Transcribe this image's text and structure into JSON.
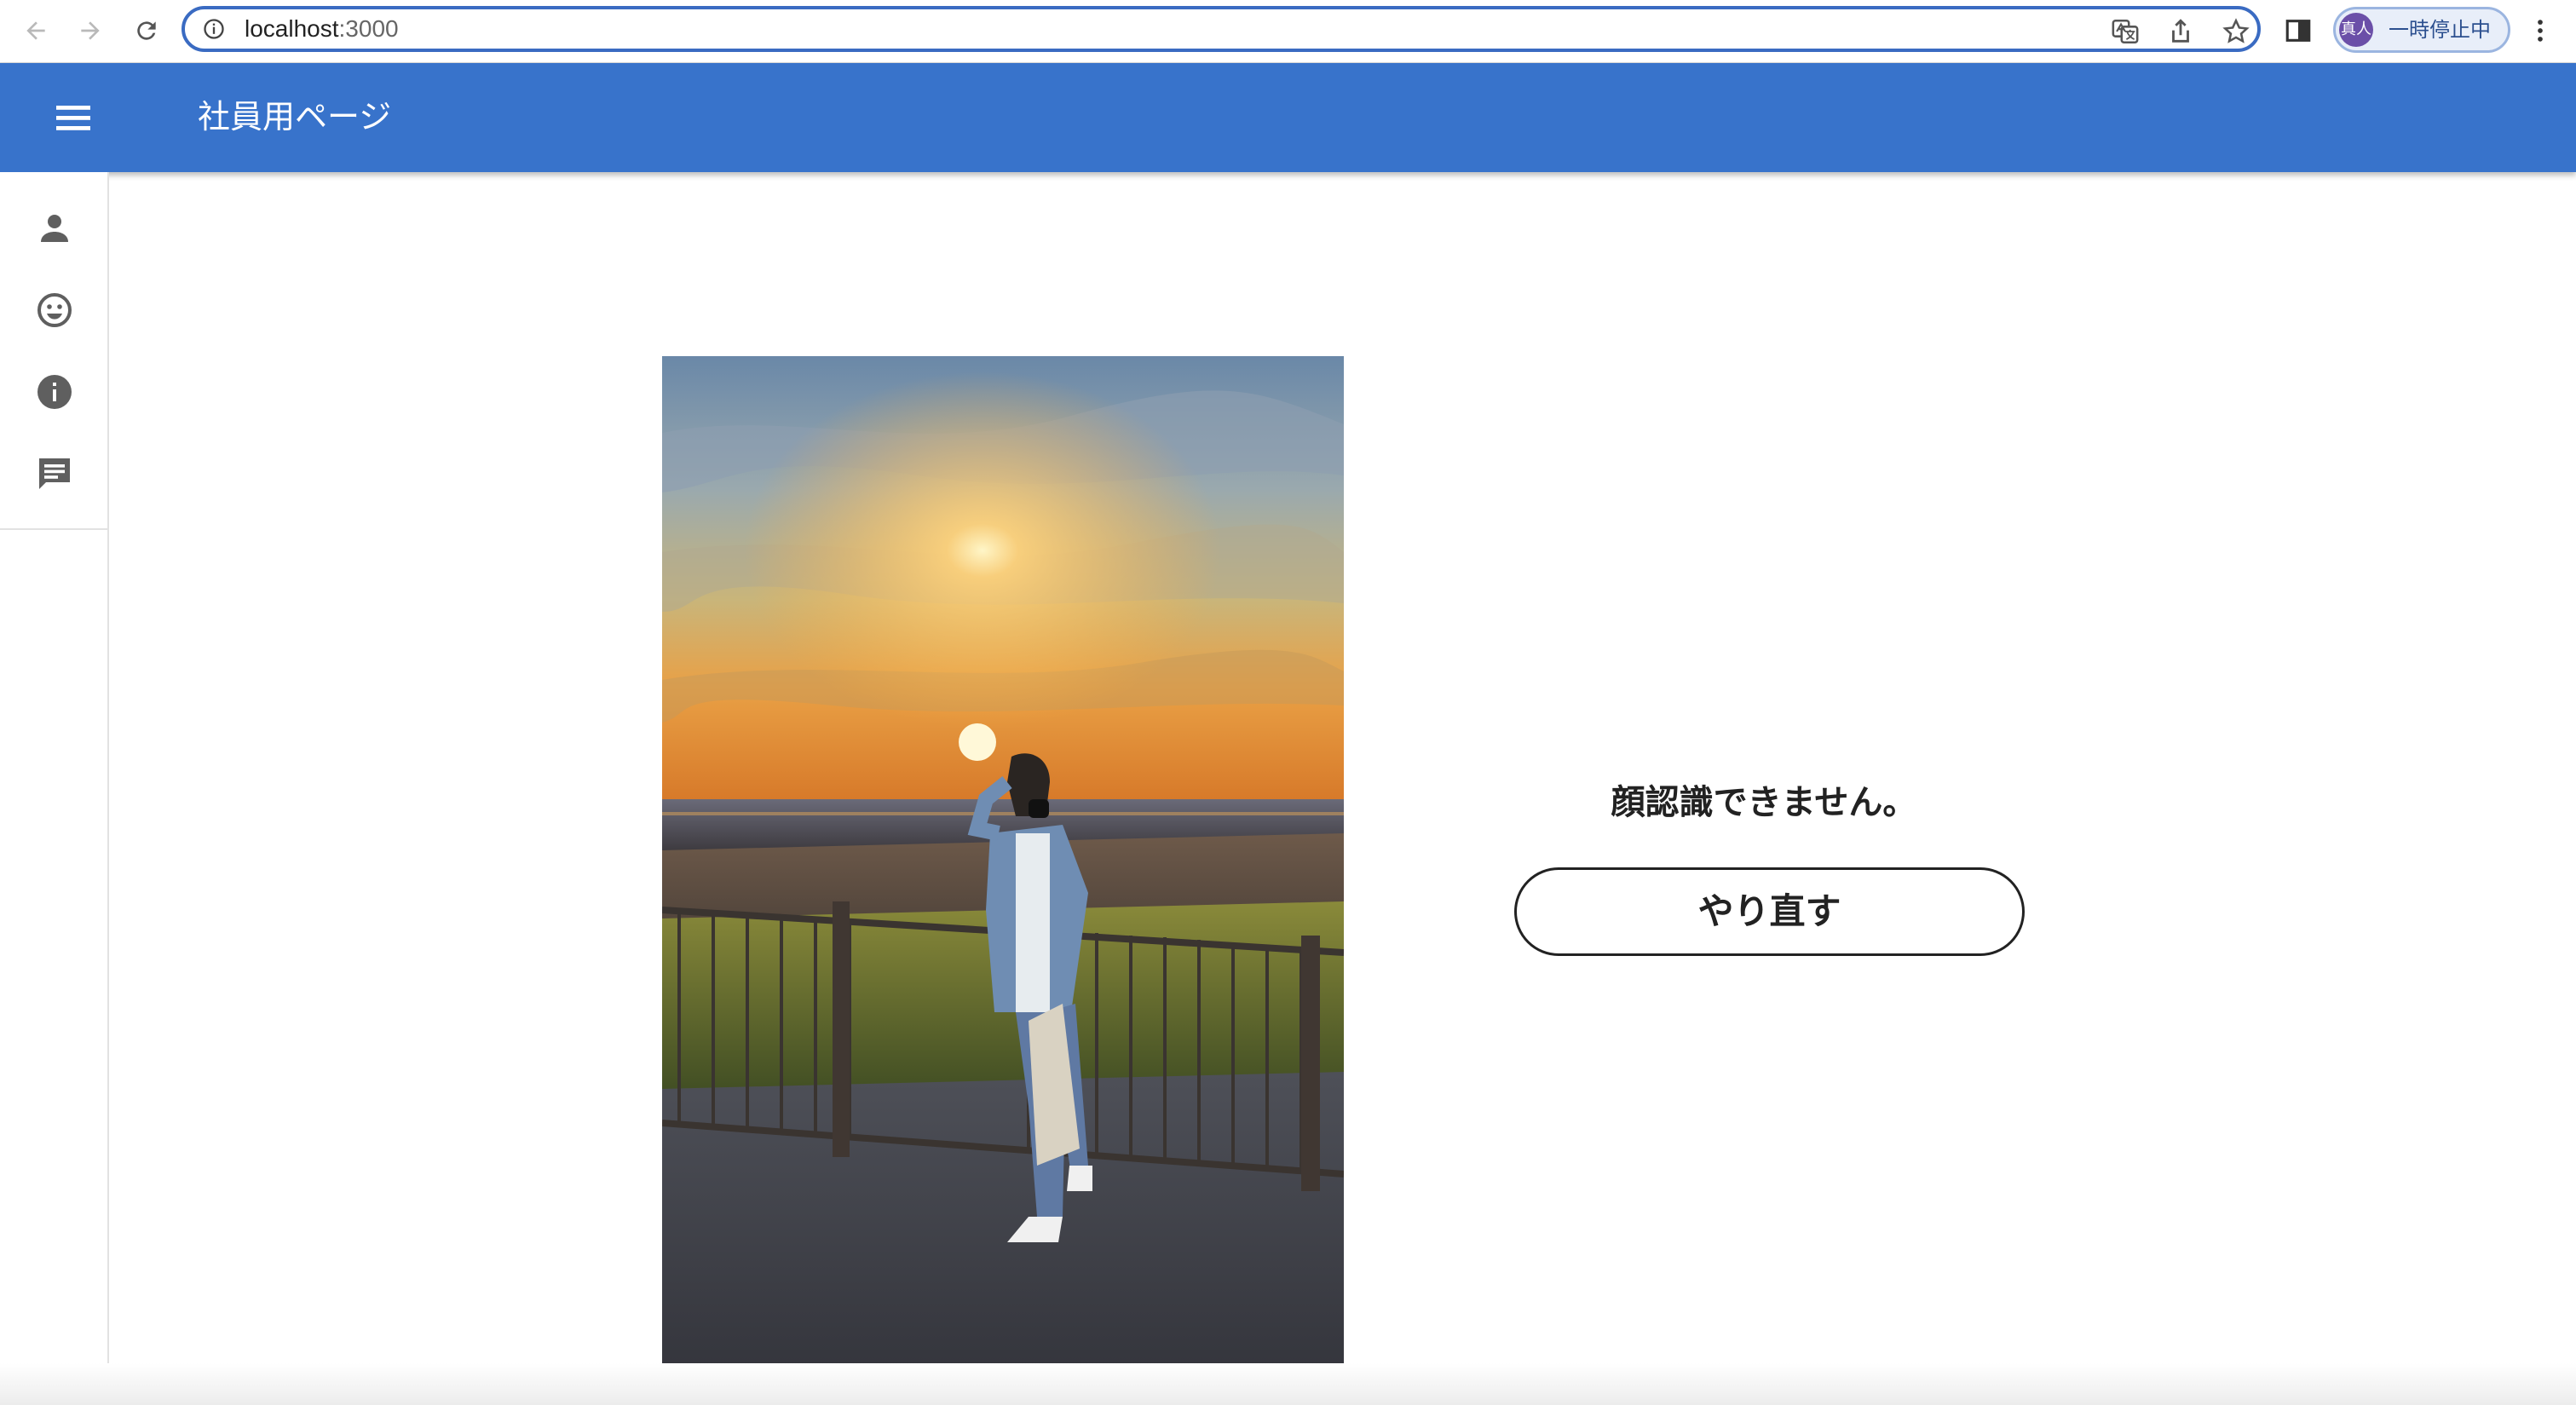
{
  "browser": {
    "url_host": "localhost",
    "url_port": ":3000",
    "profile_avatar": "真人",
    "profile_label": "一時停止中",
    "icons": [
      "back-arrow-icon",
      "forward-arrow-icon",
      "reload-icon",
      "site-info-icon",
      "translate-icon",
      "share-icon",
      "bookmark-star-icon",
      "side-panel-icon",
      "more-vert-icon"
    ]
  },
  "app": {
    "title": "社員用ページ",
    "accent_color": "#3873cb"
  },
  "side_rail": {
    "items": [
      {
        "icon": "person-icon"
      },
      {
        "icon": "face-icon"
      },
      {
        "icon": "info-icon"
      },
      {
        "icon": "chat-icon"
      }
    ]
  },
  "main": {
    "photo_alt": "person-at-seaside-sunset-photo",
    "status_message": "顔認識できません。",
    "retry_label": "やり直す"
  }
}
